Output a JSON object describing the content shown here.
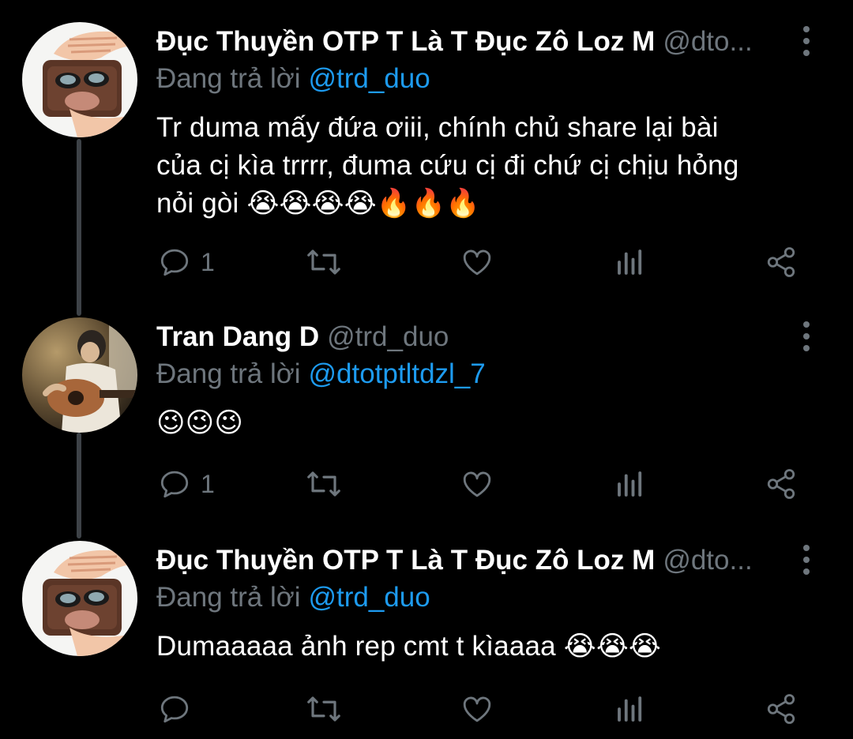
{
  "tweets": [
    {
      "display_name": "Đục Thuyền OTP T Là T Đục Zô Loz M",
      "handle": "@dto...",
      "reply_label": "Đang trả lời",
      "reply_to": "@trd_duo",
      "text": "Tr duma mấy đứa ơiii, chính chủ share lại bài\ncủa cị kìa trrrr, đuma cứu cị đi chứ cị chịu hỏng\nnỏi gòi 😭😭😭😭🔥🔥🔥",
      "reply_count": "1",
      "avatar": "hand-wallet-meme-avatar"
    },
    {
      "display_name": "Tran Dang D",
      "handle": "@trd_duo",
      "reply_label": "Đang trả lời",
      "reply_to": "@dtotptltdzl_7",
      "text": "😉😉😉",
      "reply_count": "1",
      "avatar": "guitar-player-avatar"
    },
    {
      "display_name": "Đục Thuyền OTP T Là T Đục Zô Loz M",
      "handle": "@dto...",
      "reply_label": "Đang trả lời",
      "reply_to": "@trd_duo",
      "text": "Dumaaaaa ảnh rep cmt t kìaaaa 😭😭😭",
      "reply_count": "",
      "avatar": "hand-wallet-meme-avatar"
    }
  ],
  "icons": {
    "reply": "reply-icon",
    "retweet": "retweet-icon",
    "like": "heart-icon",
    "analytics": "analytics-icon",
    "share": "share-icon",
    "more": "more-options-icon"
  },
  "colors": {
    "background": "#000000",
    "text": "#ffffff",
    "muted": "#6e767d",
    "link": "#1d9bf0",
    "thread_line": "#3d4247"
  }
}
